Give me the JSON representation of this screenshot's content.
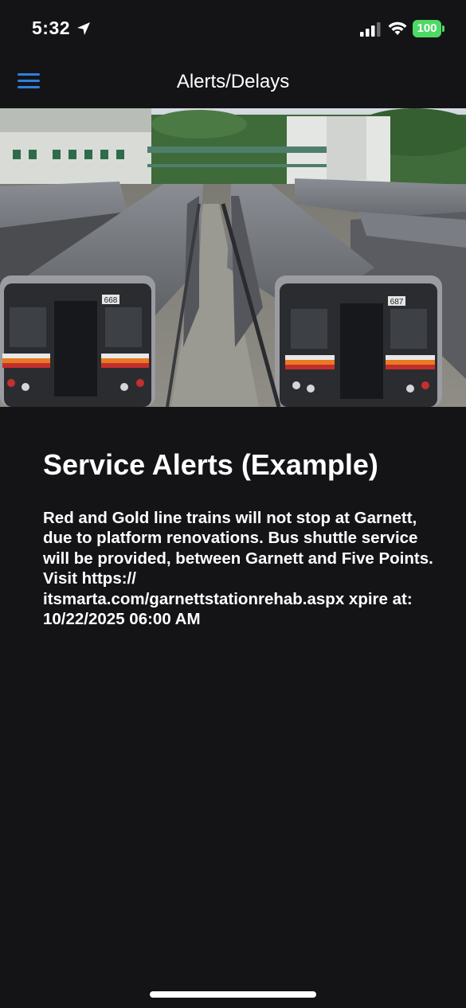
{
  "status_bar": {
    "time": "5:32",
    "battery": "100",
    "battery_color": "#4cd964",
    "icons": [
      "location-arrow-icon",
      "cellular-signal-icon",
      "wifi-icon",
      "battery-icon"
    ]
  },
  "nav": {
    "title": "Alerts/Delays",
    "menu_icon": "hamburger-menu-icon",
    "accent": "#2f7fe0"
  },
  "hero": {
    "description_icon": "train-yard-photo",
    "left_car_number": "668",
    "right_car_number": "687"
  },
  "alert": {
    "title": "Service Alerts (Example)",
    "body": "Red and Gold line trains will not stop at Garnett, due to platform renovations. Bus shuttle service will be provided, between Garnett and Five Points. Visit https:// itsmarta.com/garnettstationrehab.aspx xpire at: 10/22/2025 06:00 AM"
  },
  "colors": {
    "background": "#141416",
    "text": "#ffffff"
  }
}
